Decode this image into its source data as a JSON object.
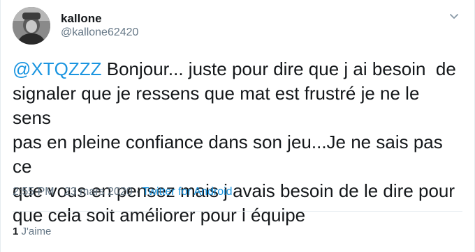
{
  "tweet": {
    "display_name": "kallone",
    "handle": "@kallone62420",
    "mention": "@XTQZZZ",
    "text": " Bonjour... juste pour dire que j ai besoin  de\nsignaler que je ressens que mat est frustré je ne le sens\npas en pleine confiance dans son jeu...Je ne sais pas ce\nque vous en pensez mais j avais besoin de le dire pour\nque cela soit améliorer pour l équipe",
    "time": "2:55 PM",
    "separator": " · ",
    "date": "23 mars 2020",
    "source": "Twitter for Android",
    "like_count": "1",
    "like_label": "J'aime"
  },
  "colors": {
    "link": "#1b95e0",
    "secondary_text": "#657786",
    "primary_text": "#14171a",
    "divider": "#e6ecf0"
  },
  "icons": {
    "menu": "chevron-down-icon",
    "avatar": "profile-photo"
  }
}
